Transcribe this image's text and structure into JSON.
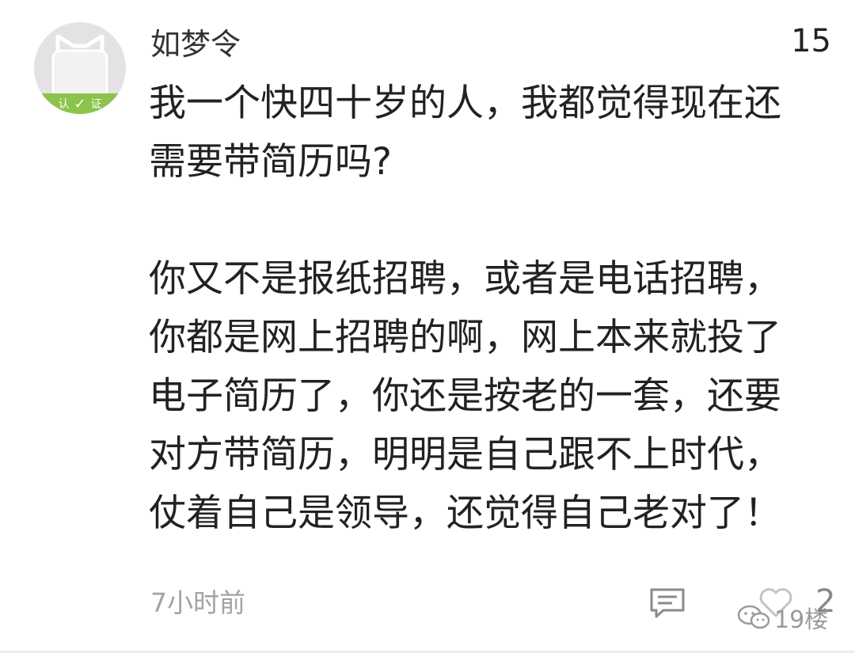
{
  "comment": {
    "username": "如梦令",
    "like_count": "15",
    "avatar_badge_left": "认",
    "avatar_badge_right": "证",
    "content_lines": [
      "我一个快四十岁的人，我都觉得现在还",
      "需要带简历吗?",
      "",
      "你又不是报纸招聘，或者是电话招聘，",
      "你都是网上招聘的啊，网上本来就投了",
      "电子简历了，你还是按老的一套，还要",
      "对方带简历，明明是自己跟不上时代，",
      "仗着自己是领导，还觉得自己老对了！"
    ],
    "time": "7小时前",
    "reply_count": "2"
  },
  "watermark": {
    "text": "19楼"
  },
  "icons": {
    "comment": "comment-bubble-icon",
    "heart": "heart-icon",
    "wechat": "wechat-icon"
  }
}
